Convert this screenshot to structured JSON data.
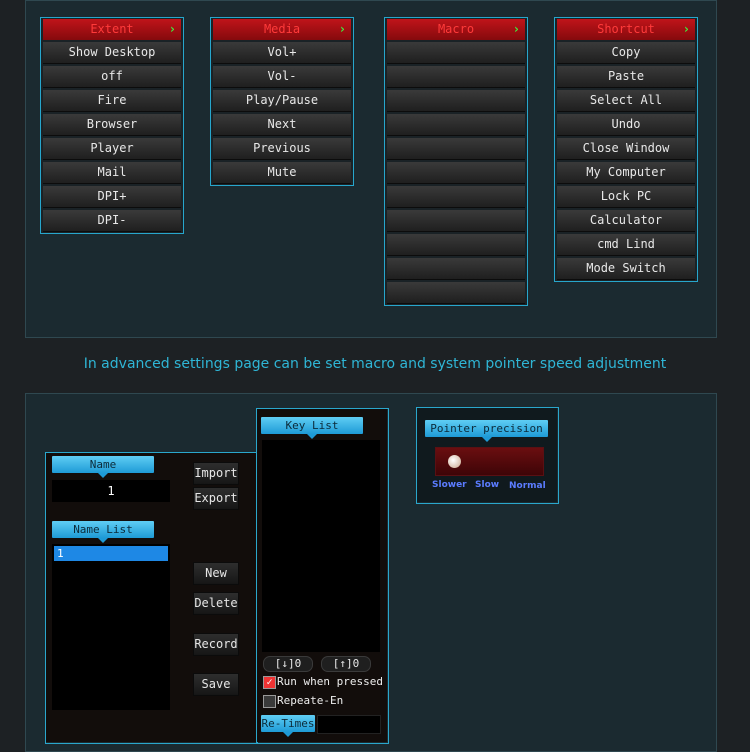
{
  "menus": [
    {
      "header": "Extent",
      "items": [
        "Show Desktop",
        "off",
        "Fire",
        "Browser",
        "Player",
        "Mail",
        "DPI+",
        "DPI-"
      ]
    },
    {
      "header": "Media",
      "items": [
        "Vol+",
        "Vol-",
        "Play/Pause",
        "Next",
        "Previous",
        "Mute"
      ]
    },
    {
      "header": "Macro",
      "items": [
        "",
        "",
        "",
        "",
        "",
        "",
        "",
        "",
        "",
        "",
        ""
      ]
    },
    {
      "header": "Shortcut",
      "items": [
        "Copy",
        "Paste",
        "Select All",
        "Undo",
        "Close Window",
        "My Computer",
        "Lock PC",
        "Calculator",
        "cmd Lind",
        "Mode Switch"
      ]
    }
  ],
  "caption": "In advanced settings page can be set macro and system pointer speed adjustment",
  "macro_editor": {
    "name_label": "Name",
    "name_value": "1",
    "name_list_label": "Name List",
    "name_list_items": [
      "1"
    ],
    "key_list_label": "Key List",
    "buttons": {
      "import": "Import",
      "export": "Export",
      "new": "New",
      "delete": "Delete",
      "record": "Record",
      "save": "Save"
    },
    "down_counter": "[↓]0",
    "up_counter": "[↑]0",
    "run_when_pressed": "Run when pressed",
    "repeat_en": "Repeate-En",
    "re_times": "Re-Times"
  },
  "pointer": {
    "title": "Pointer precision",
    "slider_value": 0,
    "labels": [
      "Slower",
      "Slow",
      "Normal"
    ]
  }
}
